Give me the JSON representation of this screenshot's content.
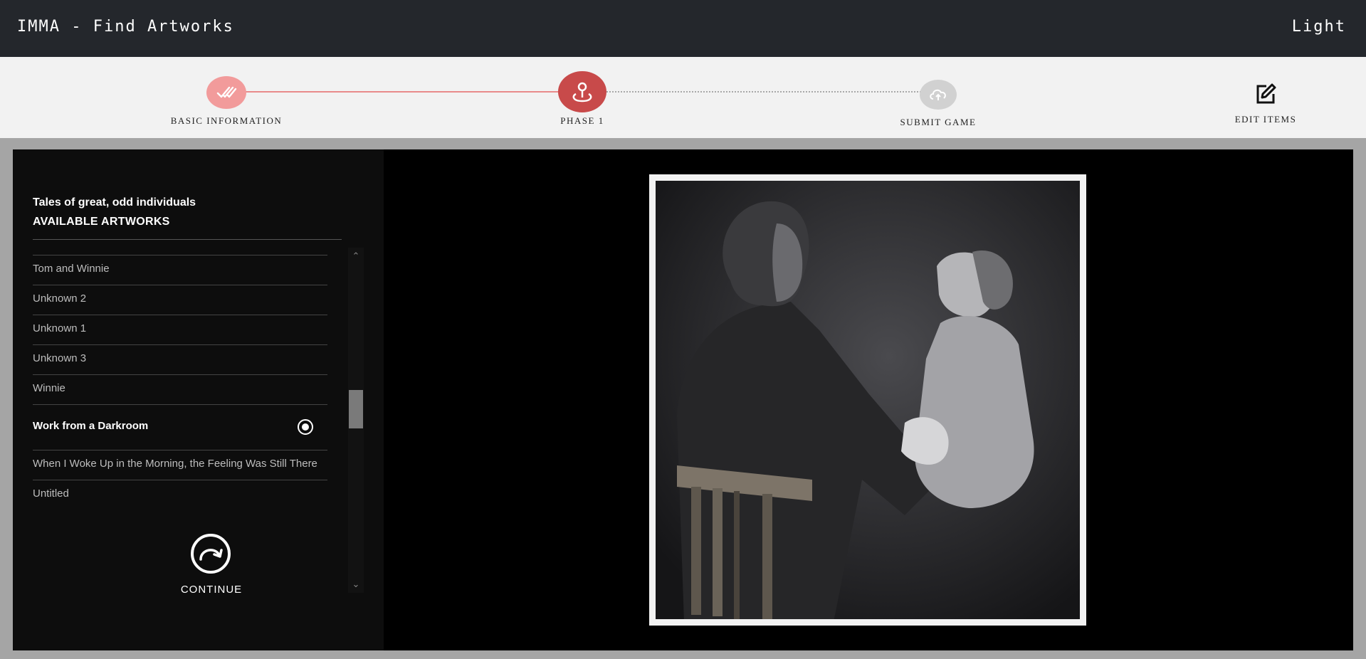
{
  "app": {
    "title": "IMMA - Find Artworks",
    "theme_toggle": "Light"
  },
  "stepper": {
    "steps": [
      {
        "label": "BASIC INFORMATION",
        "status": "completed",
        "icon": "double-check-icon"
      },
      {
        "label": "PHASE 1",
        "status": "active",
        "icon": "map-pin-icon"
      },
      {
        "label": "SUBMIT GAME",
        "status": "pending",
        "icon": "cloud-upload-icon"
      },
      {
        "label": "EDIT ITEMS",
        "status": "action",
        "icon": "edit-icon"
      }
    ],
    "colors": {
      "completed": "#f29b9b",
      "active": "#c84a4a",
      "pending": "#d1d1d1"
    }
  },
  "panel": {
    "theme_name": "Tales of great, odd individuals",
    "heading": "AVAILABLE ARTWORKS",
    "artworks": [
      "Tom and Winnie",
      "Unknown 2",
      "Unknown 1",
      "Unknown 3",
      "Winnie",
      "Work from a Darkroom",
      "When I Woke Up in the Morning, the Feeling Was Still There",
      "Untitled"
    ],
    "selected": "Work from a Darkroom",
    "continue_label": "CONTINUE"
  }
}
